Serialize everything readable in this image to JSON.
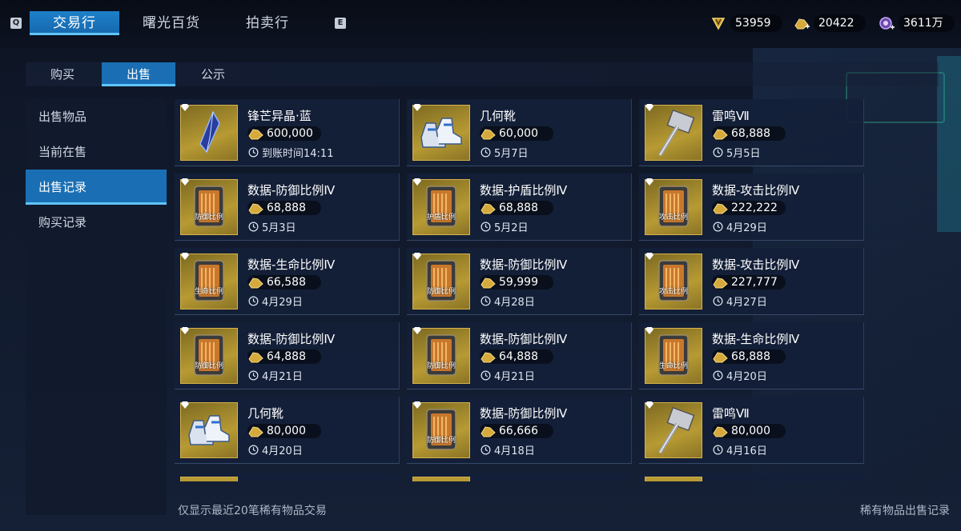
{
  "top_tabs": {
    "key_left": "Q",
    "key_right": "E",
    "items": [
      "交易行",
      "曙光百货",
      "拍卖行"
    ]
  },
  "currencies": [
    {
      "name": "currency-1",
      "value": "53959"
    },
    {
      "name": "currency-2",
      "value": "20422"
    },
    {
      "name": "currency-3",
      "value": "3611万"
    }
  ],
  "sub_tabs": [
    "购买",
    "出售",
    "公示"
  ],
  "side_menu": [
    "出售物品",
    "当前在售",
    "出售记录",
    "购买记录"
  ],
  "items": [
    {
      "name": "锋芒异晶·蓝",
      "price": "600,000",
      "date": "到账时间14:11",
      "thumb": "crystal",
      "label": ""
    },
    {
      "name": "几何靴",
      "price": "60,000",
      "date": "5月7日",
      "thumb": "boots",
      "label": ""
    },
    {
      "name": "雷鸣Ⅶ",
      "price": "68,888",
      "date": "5月5日",
      "thumb": "hammer",
      "label": ""
    },
    {
      "name": "数据-防御比例Ⅳ",
      "price": "68,888",
      "date": "5月3日",
      "thumb": "data",
      "label": "防御比例"
    },
    {
      "name": "数据-护盾比例Ⅳ",
      "price": "68,888",
      "date": "5月2日",
      "thumb": "data",
      "label": "护盾比例"
    },
    {
      "name": "数据-攻击比例Ⅳ",
      "price": "222,222",
      "date": "4月29日",
      "thumb": "data",
      "label": "攻击比例"
    },
    {
      "name": "数据-生命比例Ⅳ",
      "price": "66,588",
      "date": "4月29日",
      "thumb": "data",
      "label": "生命比例"
    },
    {
      "name": "数据-防御比例Ⅳ",
      "price": "59,999",
      "date": "4月28日",
      "thumb": "data",
      "label": "防御比例"
    },
    {
      "name": "数据-攻击比例Ⅳ",
      "price": "227,777",
      "date": "4月27日",
      "thumb": "data",
      "label": "攻击比例"
    },
    {
      "name": "数据-防御比例Ⅳ",
      "price": "64,888",
      "date": "4月21日",
      "thumb": "data",
      "label": "防御比例"
    },
    {
      "name": "数据-防御比例Ⅳ",
      "price": "64,888",
      "date": "4月21日",
      "thumb": "data",
      "label": "防御比例"
    },
    {
      "name": "数据-生命比例Ⅳ",
      "price": "68,888",
      "date": "4月20日",
      "thumb": "data",
      "label": "生命比例"
    },
    {
      "name": "几何靴",
      "price": "80,000",
      "date": "4月20日",
      "thumb": "boots",
      "label": ""
    },
    {
      "name": "数据-防御比例Ⅳ",
      "price": "66,666",
      "date": "4月18日",
      "thumb": "data",
      "label": "防御比例"
    },
    {
      "name": "雷鸣Ⅶ",
      "price": "80,000",
      "date": "4月16日",
      "thumb": "hammer",
      "label": ""
    }
  ],
  "footer": {
    "note": "仅显示最近20笔稀有物品交易",
    "title": "稀有物品出售记录"
  },
  "colors": {
    "accent": "#1a6fb4",
    "gold": "#d8b24a"
  }
}
